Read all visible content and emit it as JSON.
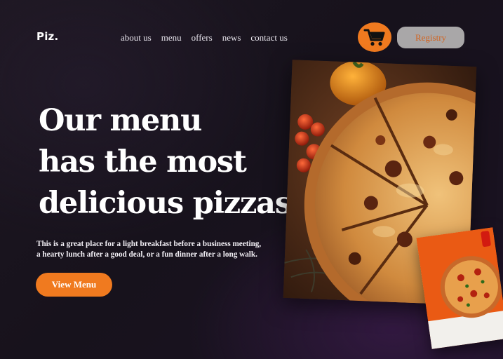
{
  "brand": {
    "logo": "Piz."
  },
  "nav": {
    "items": [
      {
        "label": "about us"
      },
      {
        "label": "menu"
      },
      {
        "label": "offers"
      },
      {
        "label": "news"
      },
      {
        "label": "contact us"
      }
    ]
  },
  "header": {
    "cart_icon": "shopping-cart-icon",
    "registry_label": "Registry"
  },
  "hero": {
    "headline_lines": [
      "Our menu",
      "has the most",
      "delicious pizzas"
    ],
    "description_line1": "This is a great place for a light breakfast before a business meeting,",
    "description_line2": "a hearty lunch after a good deal, or a fun dinner after a long walk.",
    "cta_label": "View Menu"
  },
  "colors": {
    "accent": "#f07a1f",
    "background": "#1a1420",
    "registry_bg": "#a9a7a8",
    "registry_text": "#d2631f"
  }
}
